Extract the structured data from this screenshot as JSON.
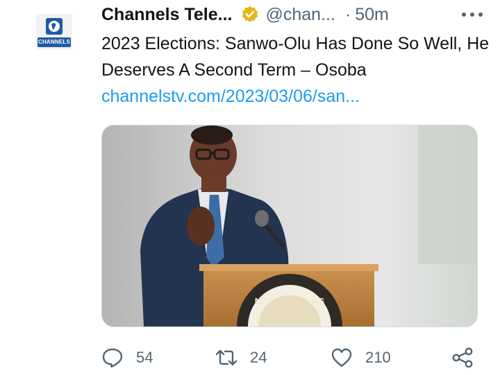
{
  "author": {
    "name": "Channels Tele...",
    "handle": "@chan...",
    "separator": "·",
    "time": "50m",
    "avatar_label": "CHANNELS"
  },
  "tweet": {
    "text": "2023 Elections: Sanwo-Olu Has Done So Well, He Deserves A Second Term – Osoba",
    "link": "channelstv.com/2023/03/06/san..."
  },
  "media": {
    "seal_text": "NOR OF LAGOS"
  },
  "actions": {
    "replies": "54",
    "retweets": "24",
    "likes": "210"
  },
  "icons": {
    "verified": "verified-badge-icon",
    "more": "more-options-icon",
    "reply": "reply-icon",
    "retweet": "retweet-icon",
    "like": "heart-icon",
    "share": "share-icon"
  },
  "colors": {
    "link": "#1d9bf0",
    "secondary_text": "#536471",
    "verified_gold": "#e2b719",
    "brand_blue": "#1f5aa6"
  }
}
